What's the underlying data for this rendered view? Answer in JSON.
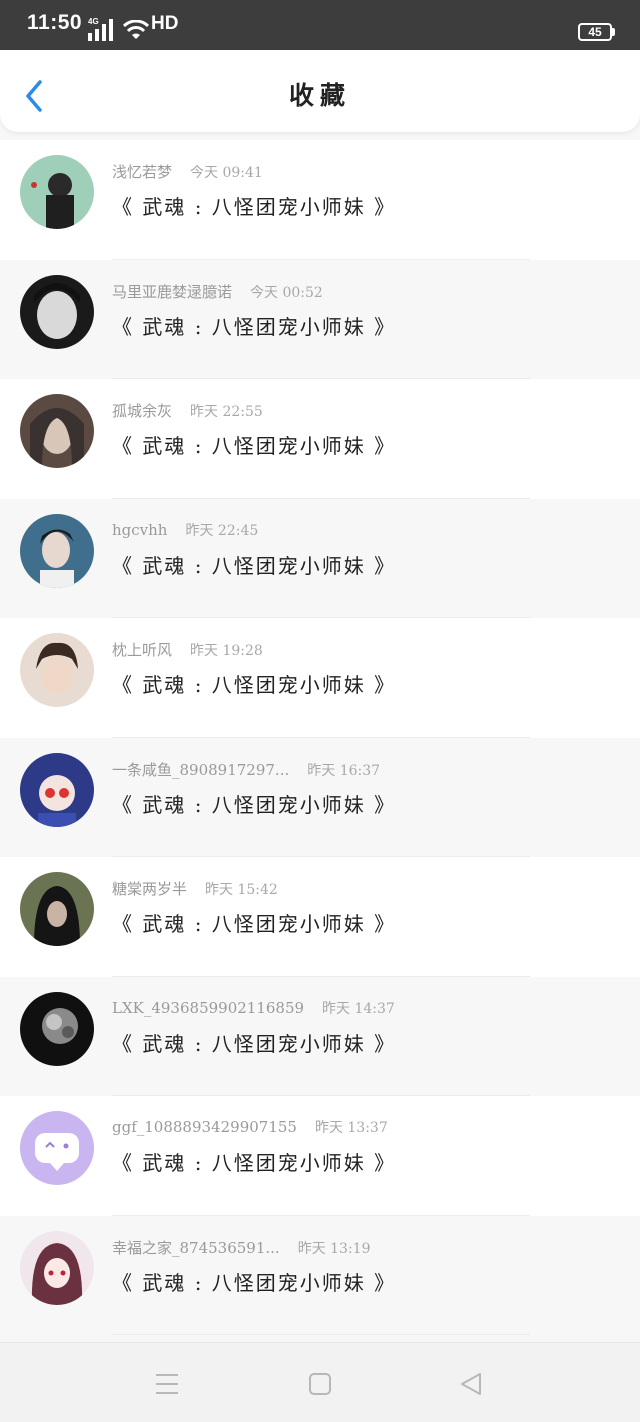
{
  "status_bar": {
    "time": "11:50",
    "network": "4G",
    "hd": "HD",
    "battery": "45"
  },
  "header": {
    "title": "收藏"
  },
  "items": [
    {
      "user": "浅忆若梦",
      "time": "今天 09:41",
      "title": "《 武魂 : 八怪团宠小师妹 》"
    },
    {
      "user": "马里亚鹿婪逯臆诺",
      "time": "今天 00:52",
      "title": "《 武魂 : 八怪团宠小师妹 》"
    },
    {
      "user": "孤城余灰",
      "time": "昨天 22:55",
      "title": "《 武魂 : 八怪团宠小师妹 》"
    },
    {
      "user": "hgcvhh",
      "time": "昨天 22:45",
      "title": "《 武魂 : 八怪团宠小师妹 》"
    },
    {
      "user": "枕上听风",
      "time": "昨天 19:28",
      "title": "《 武魂 : 八怪团宠小师妹 》"
    },
    {
      "user": "一条咸鱼_8908917297...",
      "time": "昨天 16:37",
      "title": "《 武魂 : 八怪团宠小师妹 》"
    },
    {
      "user": "糖棠两岁半",
      "time": "昨天 15:42",
      "title": "《 武魂 : 八怪团宠小师妹 》"
    },
    {
      "user": "LXK_4936859902116859",
      "time": "昨天 14:37",
      "title": "《 武魂 : 八怪团宠小师妹 》"
    },
    {
      "user": "ggf_1088893429907155",
      "time": "昨天 13:37",
      "title": "《 武魂 : 八怪团宠小师妹 》"
    },
    {
      "user": "幸福之家_874536591...",
      "time": "昨天 13:19",
      "title": "《 武魂 : 八怪团宠小师妹 》"
    }
  ],
  "nav": {
    "menu_icon": "menu-icon",
    "home_icon": "home-square-icon",
    "back_icon": "back-triangle-icon"
  },
  "colors": {
    "accent": "#2d8be6",
    "status_bg": "#3d3d3d"
  }
}
